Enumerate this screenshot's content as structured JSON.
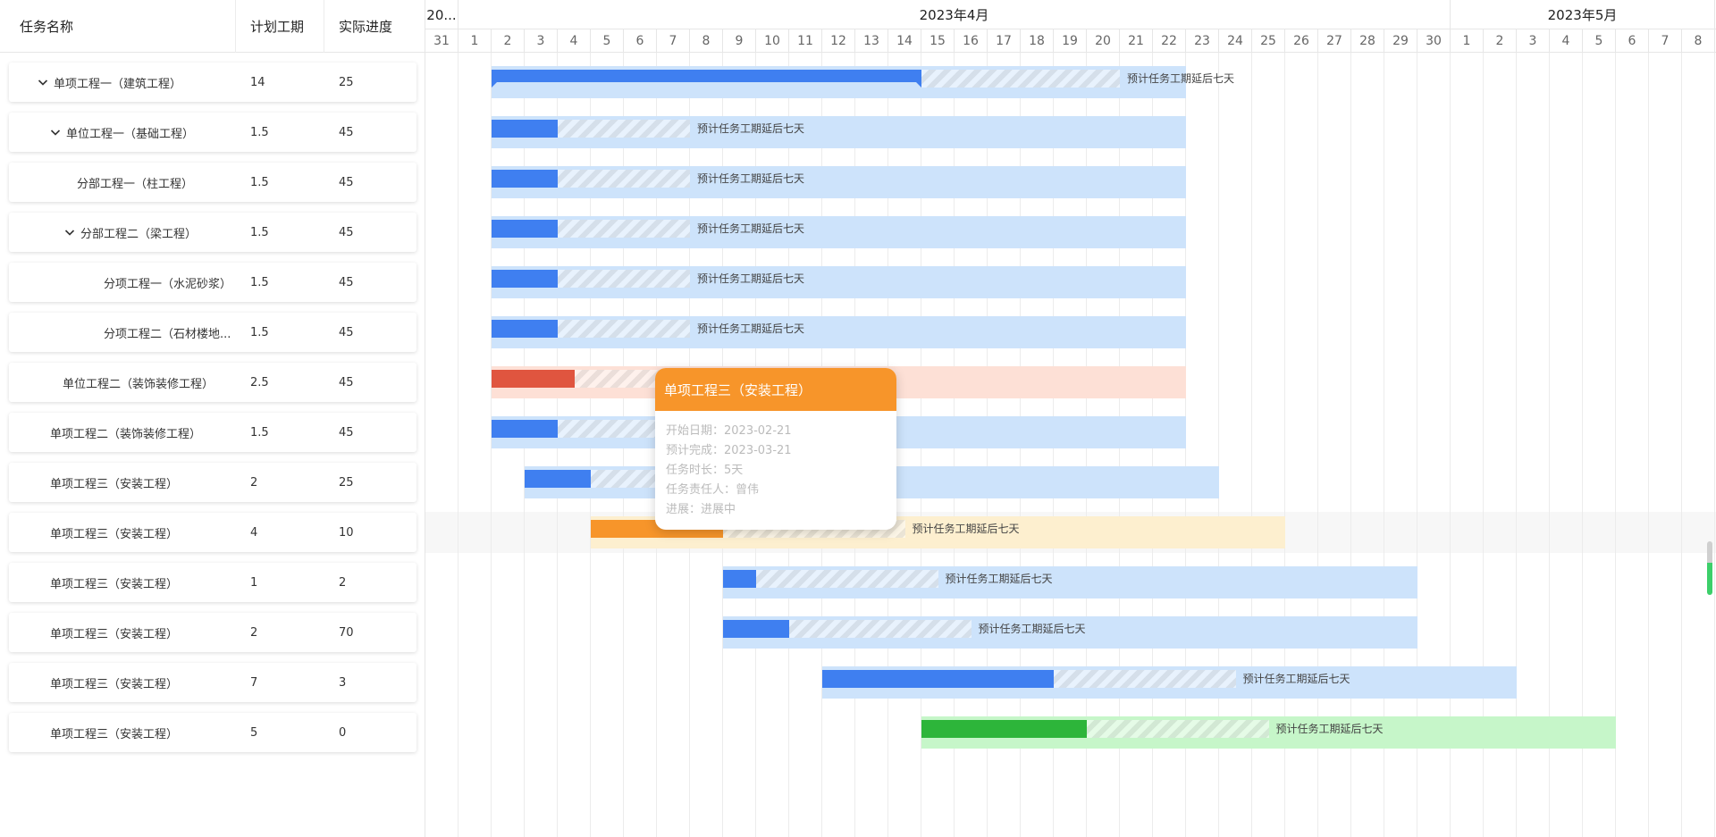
{
  "left_table": {
    "headers": {
      "name": "任务名称",
      "plan": "计划工期",
      "progress": "实际进度"
    },
    "rows": [
      {
        "name": "单项工程一（建筑工程）",
        "plan": "14",
        "progress": "25",
        "indent": 1,
        "expand": true
      },
      {
        "name": "单位工程一（基础工程）",
        "plan": "1.5",
        "progress": "45",
        "indent": 2,
        "expand": true
      },
      {
        "name": "分部工程一（柱工程）",
        "plan": "1.5",
        "progress": "45",
        "indent": 3,
        "expand": false
      },
      {
        "name": "分部工程二（梁工程）",
        "plan": "1.5",
        "progress": "45",
        "indent": 3,
        "expand": true
      },
      {
        "name": "分项工程一（水泥砂浆）",
        "plan": "1.5",
        "progress": "45",
        "indent": 4,
        "expand": false
      },
      {
        "name": "分项工程二（石材楼地...",
        "plan": "1.5",
        "progress": "45",
        "indent": 4,
        "expand": false
      },
      {
        "name": "单位工程二（装饰装修工程）",
        "plan": "2.5",
        "progress": "45",
        "indent": 2,
        "expand": false
      },
      {
        "name": "单项工程二（装饰装修工程）",
        "plan": "1.5",
        "progress": "45",
        "indent": 1,
        "expand": false
      },
      {
        "name": "单项工程三（安装工程）",
        "plan": "2",
        "progress": "25",
        "indent": 1,
        "expand": false
      },
      {
        "name": "单项工程三（安装工程）",
        "plan": "4",
        "progress": "10",
        "indent": 1,
        "expand": false
      },
      {
        "name": "单项工程三（安装工程）",
        "plan": "1",
        "progress": "2",
        "indent": 1,
        "expand": false
      },
      {
        "name": "单项工程三（安装工程）",
        "plan": "2",
        "progress": "70",
        "indent": 1,
        "expand": false
      },
      {
        "name": "单项工程三（安装工程）",
        "plan": "7",
        "progress": "3",
        "indent": 1,
        "expand": false
      },
      {
        "name": "单项工程三（安装工程）",
        "plan": "5",
        "progress": "0",
        "indent": 1,
        "expand": false
      }
    ]
  },
  "timeline": {
    "months": [
      {
        "label": "20...",
        "days": [
          "31"
        ]
      },
      {
        "label": "2023年4月",
        "days": [
          "1",
          "2",
          "3",
          "4",
          "5",
          "6",
          "7",
          "8",
          "9",
          "10",
          "11",
          "12",
          "13",
          "14",
          "15",
          "16",
          "17",
          "18",
          "19",
          "20",
          "21",
          "22",
          "23",
          "24",
          "25",
          "26",
          "27",
          "28",
          "29",
          "30"
        ]
      },
      {
        "label": "2023年5月",
        "days": [
          "1",
          "2",
          "3",
          "4",
          "5",
          "6",
          "7",
          "8"
        ]
      }
    ]
  },
  "bars": [
    {
      "start": 2,
      "end": 23,
      "fill_end": 15,
      "stripe_end": 21,
      "label": "预计任务工期延后七天",
      "bg": "#cde3fb",
      "fill": "#3f7ff0",
      "summary": true
    },
    {
      "start": 2,
      "end": 23,
      "fill_end": 4,
      "stripe_end": 8,
      "label": "预计任务工期延后七天",
      "bg": "#cde3fb",
      "fill": "#3f7ff0"
    },
    {
      "start": 2,
      "end": 23,
      "fill_end": 4,
      "stripe_end": 8,
      "label": "预计任务工期延后七天",
      "bg": "#cde3fb",
      "fill": "#3f7ff0"
    },
    {
      "start": 2,
      "end": 23,
      "fill_end": 4,
      "stripe_end": 8,
      "label": "预计任务工期延后七天",
      "bg": "#cde3fb",
      "fill": "#3f7ff0"
    },
    {
      "start": 2,
      "end": 23,
      "fill_end": 4,
      "stripe_end": 8,
      "label": "预计任务工期延后七天",
      "bg": "#cde3fb",
      "fill": "#3f7ff0"
    },
    {
      "start": 2,
      "end": 23,
      "fill_end": 4,
      "stripe_end": 8,
      "label": "预计任务工期延后七天",
      "bg": "#cde3fb",
      "fill": "#3f7ff0"
    },
    {
      "start": 2,
      "end": 23,
      "fill_end": 4.5,
      "stripe_end": 8,
      "label": "",
      "bg": "#fde0d6",
      "fill": "#e0553f"
    },
    {
      "start": 2,
      "end": 23,
      "fill_end": 4,
      "stripe_end": 8,
      "label": "",
      "bg": "#cde3fb",
      "fill": "#3f7ff0"
    },
    {
      "start": 3,
      "end": 24,
      "fill_end": 5,
      "stripe_end": 9,
      "label": "",
      "bg": "#cde3fb",
      "fill": "#3f7ff0"
    },
    {
      "start": 5,
      "end": 26,
      "fill_end": 9,
      "stripe_end": 14.5,
      "label": "预计任务工期延后七天",
      "bg": "#fdefcf",
      "fill": "#f7952a"
    },
    {
      "start": 9,
      "end": 30,
      "fill_end": 10,
      "stripe_end": 15.5,
      "label": "预计任务工期延后七天",
      "bg": "#cde3fb",
      "fill": "#3f7ff0"
    },
    {
      "start": 9,
      "end": 30,
      "fill_end": 11,
      "stripe_end": 16.5,
      "label": "预计任务工期延后七天",
      "bg": "#cde3fb",
      "fill": "#3f7ff0"
    },
    {
      "start": 12,
      "end": 33,
      "fill_end": 19,
      "stripe_end": 24.5,
      "label": "预计任务工期延后七天",
      "bg": "#cde3fb",
      "fill": "#3f7ff0"
    },
    {
      "start": 15,
      "end": 36,
      "fill_end": 20,
      "stripe_end": 25.5,
      "label": "预计任务工期延后七天",
      "bg": "#c6f6c9",
      "fill": "#2db53a"
    }
  ],
  "hover_row": 9,
  "tooltip": {
    "title": "单项工程三（安装工程）",
    "start_label": "开始日期：",
    "start_value": "2023-02-21",
    "end_label": "预计完成：",
    "end_value": "2023-03-21",
    "duration_label": "任务时长：",
    "duration_value": "5天",
    "owner_label": "任务责任人：",
    "owner_value": "曾伟",
    "status_label": "进展：",
    "status_value": "进展中"
  },
  "colors": {
    "accent_orange": "#f7952a",
    "bar_blue": "#3f7ff0",
    "bar_bg_blue": "#cde3fb",
    "grid": "#e6e6e6"
  }
}
